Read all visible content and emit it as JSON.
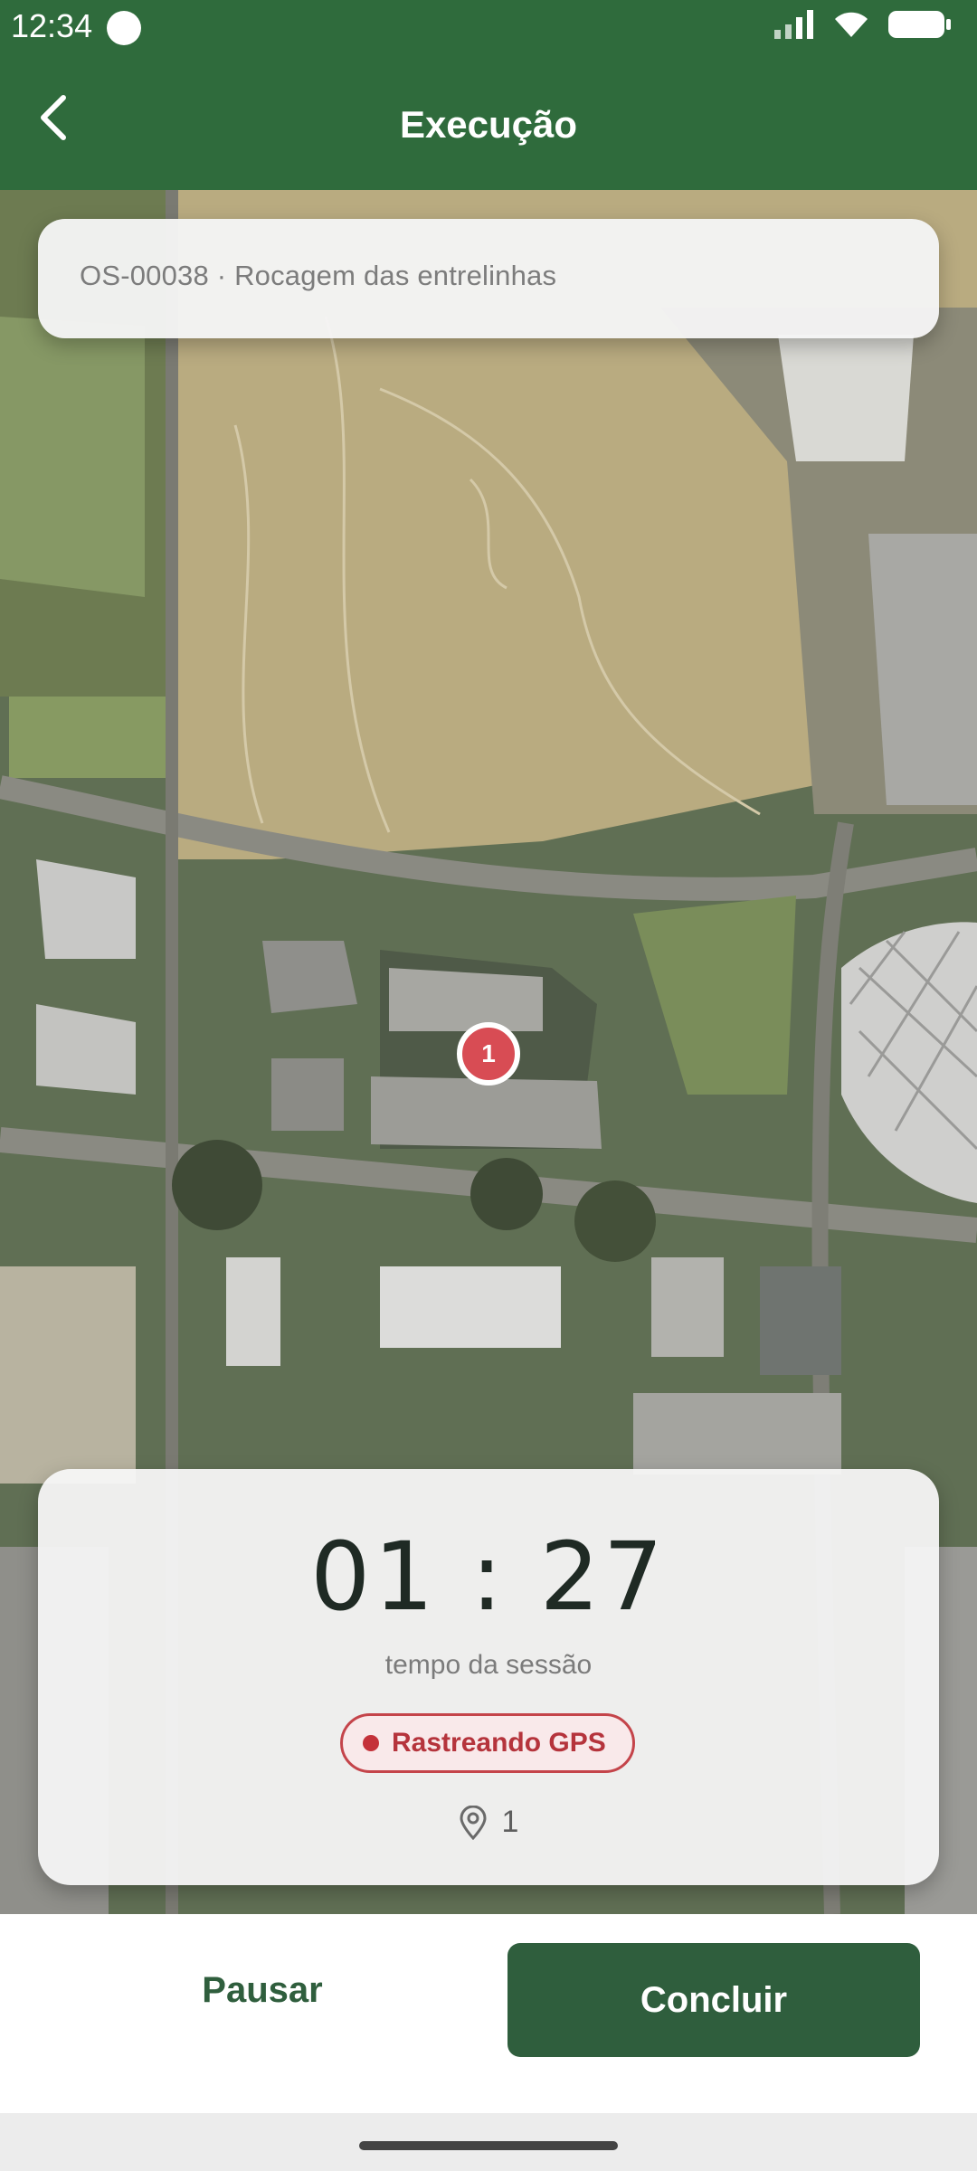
{
  "status": {
    "time": "12:34"
  },
  "header": {
    "title": "Execução"
  },
  "order": {
    "label": "OS-00038 · Rocagem das entrelinhas"
  },
  "map": {
    "marker_number": "1"
  },
  "session": {
    "timer": "01 : 27",
    "caption": "tempo da sessão",
    "gps_badge": "Rastreando GPS",
    "points": "1"
  },
  "actions": {
    "pause": "Pausar",
    "conclude": "Concluir"
  }
}
